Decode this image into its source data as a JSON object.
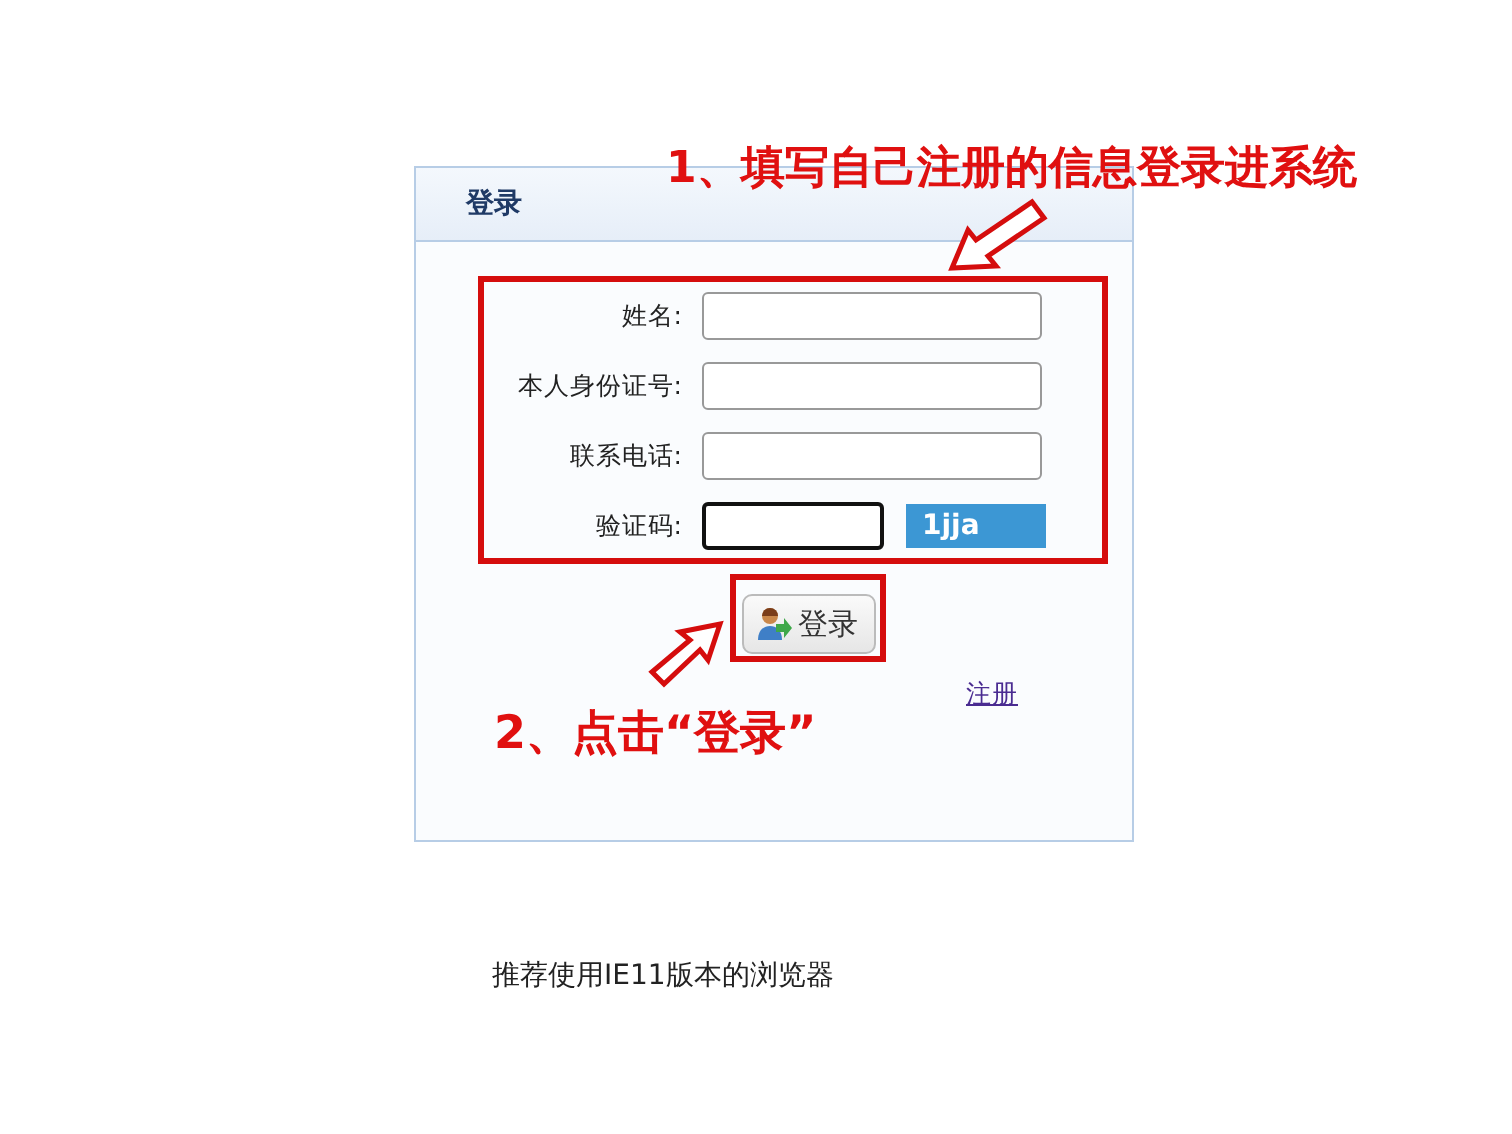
{
  "login_panel": {
    "title": "登录",
    "fields": [
      {
        "label": "姓名:",
        "kind": "text"
      },
      {
        "label": "本人身份证号:",
        "kind": "text"
      },
      {
        "label": "联系电话:",
        "kind": "text"
      },
      {
        "label": "验证码:",
        "kind": "captcha",
        "captcha": "1jja"
      }
    ],
    "login_button": "登录",
    "register_link": "注册"
  },
  "footer_note": "推荐使用IE11版本的浏览器",
  "annotations": [
    {
      "text": "1、填写自己注册的信息登录进系统"
    },
    {
      "text": "2、点击“登录”"
    }
  ]
}
